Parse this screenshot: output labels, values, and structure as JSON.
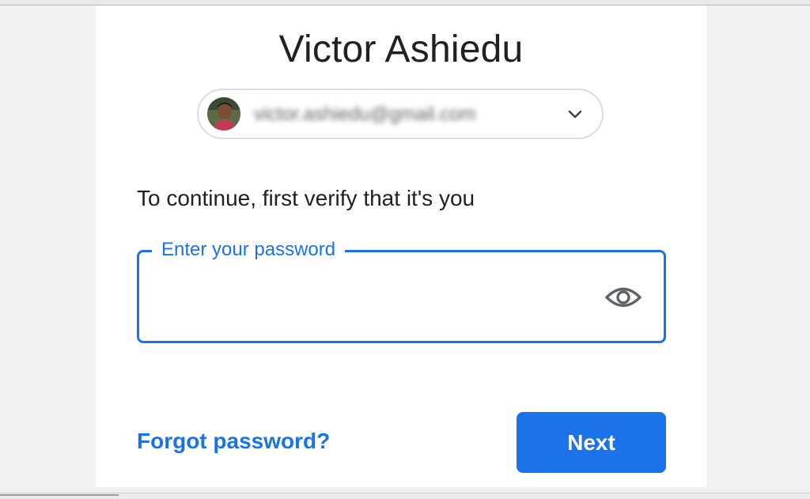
{
  "header": {
    "title": "Victor Ashiedu"
  },
  "account": {
    "avatar_icon": "user-avatar",
    "email": "victor.ashiedu@gmail.com",
    "email_blurred": true,
    "dropdown_icon": "chevron-down-icon"
  },
  "prompt": {
    "text": "To continue, first verify that it's you"
  },
  "password": {
    "label": "Enter your password",
    "value": "",
    "toggle_icon": "eye-icon",
    "state": "focused"
  },
  "actions": {
    "forgot_label": "Forgot password?",
    "next_label": "Next"
  },
  "colors": {
    "accent": "#1a73e8",
    "text_primary": "#202124",
    "border": "#dadce0",
    "background": "#ffffff"
  }
}
